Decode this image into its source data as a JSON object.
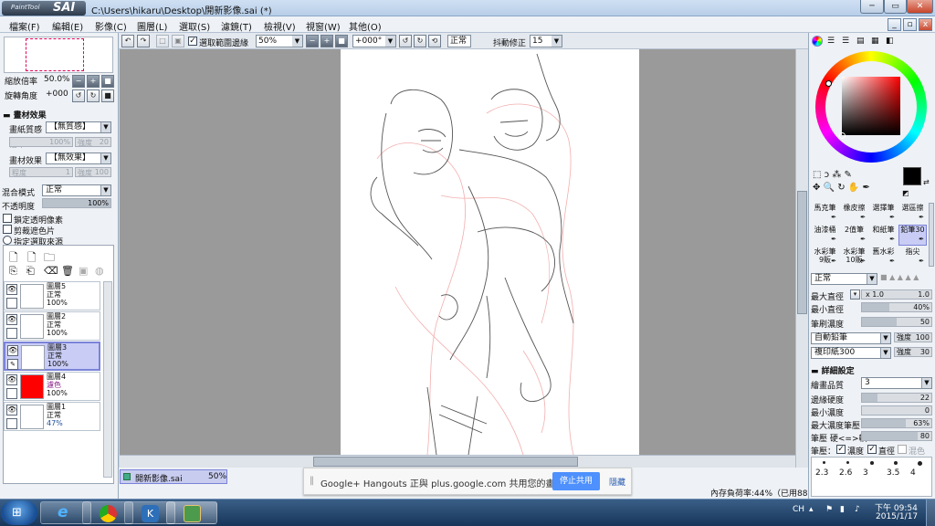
{
  "window": {
    "app_logo_small": "PaintTool",
    "app_logo_big": "SAI",
    "title": "C:\\Users\\hikaru\\Desktop\\開新影像.sai (*)",
    "minimize": "─",
    "maximize": "▭",
    "close": "✕"
  },
  "menu": [
    "檔案(F)",
    "編輯(E)",
    "影像(C)",
    "圖層(L)",
    "選取(S)",
    "濾鏡(T)",
    "檢視(V)",
    "視窗(W)",
    "其他(O)"
  ],
  "toolbar": {
    "select_bounds_label": "選取範圍邊緣",
    "zoom_value": "50%",
    "rotation_value": "+000°",
    "blend_mode": "正常",
    "stabilizer_label": "抖動修正",
    "stabilizer_value": "15"
  },
  "navigator": {
    "zoom_label": "縮放倍率",
    "zoom_value": "50.0%",
    "rotate_label": "旋轉角度",
    "rotate_value": "+000"
  },
  "texture": {
    "section": "畫材效果",
    "paper_label": "畫紙質感",
    "paper_value": "【無質感】",
    "scale_label": "倍率",
    "scale_value": "100%",
    "strength_label": "強度",
    "strength_value": "20",
    "effect_label": "畫材效果",
    "effect_value": "【無效果】",
    "degree_label": "程度",
    "degree_value": "1",
    "effect_strength_label": "強度",
    "effect_strength_value": "100"
  },
  "layer_props": {
    "blend_label": "混合模式",
    "blend_value": "正常",
    "opacity_label": "不透明度",
    "opacity_value": "100%",
    "opacity_fraction": 1.0,
    "lock_alpha": "鎖定透明像素",
    "clip_group": "剪裁遮色片",
    "selection_source": "指定選取來源"
  },
  "layers": [
    {
      "name": "圖層5",
      "mode": "正常",
      "opacity": "100%",
      "selected": false,
      "mode_color": "#111111",
      "opacity_color": "#111111",
      "thumb_color": "#ffffff"
    },
    {
      "name": "圖層2",
      "mode": "正常",
      "opacity": "100%",
      "selected": false,
      "mode_color": "#111111",
      "opacity_color": "#111111",
      "thumb_color": "#ffffff"
    },
    {
      "name": "圖層3",
      "mode": "正常",
      "opacity": "100%",
      "selected": true,
      "mode_color": "#111111",
      "opacity_color": "#111111",
      "thumb_color": "#ffffff"
    },
    {
      "name": "圖層4",
      "mode": "濾色",
      "opacity": "100%",
      "selected": false,
      "mode_color": "#8a1f8a",
      "opacity_color": "#111111",
      "thumb_color": "#ff0000"
    },
    {
      "name": "圖層1",
      "mode": "正常",
      "opacity": "47%",
      "selected": false,
      "mode_color": "#111111",
      "opacity_color": "#1f4f9a",
      "thumb_color": "#ffffff"
    }
  ],
  "document_tab": {
    "name": "開新影像.sai",
    "zoom": "50%"
  },
  "notification": {
    "message": "Google+ Hangouts 正與 plus.google.com 共用您的畫面。",
    "stop_share": "停止共用",
    "hide": "隱藏"
  },
  "status": {
    "memory": "內存負荷率:44%（已用88MB/749MB)",
    "keys": [
      "Shift",
      "Ctrl",
      "Alt",
      "SPC",
      "✥",
      "Any"
    ]
  },
  "brushes": [
    {
      "label": "馬克筆",
      "selected": false
    },
    {
      "label": "橡皮擦",
      "selected": false
    },
    {
      "label": "選擇筆",
      "selected": false
    },
    {
      "label": "選區擦",
      "selected": false
    },
    {
      "label": "油漆桶",
      "selected": false
    },
    {
      "label": "2值筆",
      "selected": false
    },
    {
      "label": "和紙筆",
      "selected": false
    },
    {
      "label": "鉛筆30",
      "selected": true
    },
    {
      "label": "水彩筆 9販",
      "selected": false
    },
    {
      "label": "水彩筆 10販",
      "selected": false
    },
    {
      "label": "舊水彩",
      "selected": false
    },
    {
      "label": "指尖",
      "selected": false
    }
  ],
  "brush_settings": {
    "mode": "正常",
    "max_size_label": "最大直徑",
    "max_size_mult": "x 1.0",
    "max_size_value": "1.0",
    "min_size_label": "最小直徑",
    "min_size_value": "40%",
    "min_size_fraction": 0.4,
    "density_label": "筆刷濃度",
    "density_value": "50",
    "density_fraction": 0.5,
    "shape": "自動鉛筆",
    "shape_strength_label": "強度",
    "shape_strength_value": "100",
    "texture": "複印紙300",
    "texture_strength_label": "強度",
    "texture_strength_value": "30",
    "details_section": "詳細設定",
    "quality_label": "繪畫品質",
    "quality_value": "3",
    "edge_hardness_label": "邊緣硬度",
    "edge_hardness_value": "22",
    "edge_hardness_fraction": 0.22,
    "min_density_label": "最小濃度",
    "min_density_value": "0",
    "min_density_fraction": 0.0,
    "max_density_pressure_label": "最大濃度筆壓",
    "max_density_pressure_value": "63%",
    "max_density_pressure_fraction": 0.63,
    "pressure_label": "筆壓 硬<=>軟",
    "pressure_value": "80",
    "pressure_fraction": 0.8,
    "pressure_opts_label": "筆壓：",
    "opt_density": "濃度",
    "opt_size": "直徑",
    "opt_blend": "混色"
  },
  "brush_sizes": [
    "2.3",
    "2.6",
    "3",
    "3.5",
    "4"
  ],
  "colors": {
    "foreground": "#000000",
    "background": "#ffffff",
    "wheel_hue": "#ff0000"
  },
  "taskbar": {
    "lang": "CH",
    "time": "下午 09:54",
    "date": "2015/1/17"
  }
}
